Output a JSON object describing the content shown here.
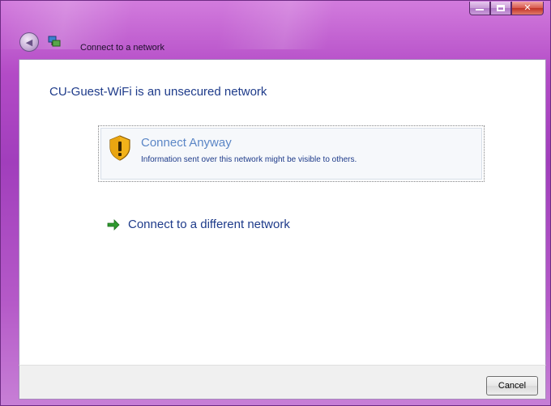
{
  "window": {
    "title": "Connect to a network"
  },
  "content": {
    "heading": "CU-Guest-WiFi is an unsecured network",
    "options": [
      {
        "title": "Connect Anyway",
        "description": "Information sent over this network might be visible to others."
      }
    ],
    "different_network_link": "Connect to a different network"
  },
  "footer": {
    "cancel_label": "Cancel"
  },
  "colors": {
    "frame_accent": "#b34bc6",
    "heading_text": "#1e3b8a",
    "link_text": "#5b86c6",
    "arrow_green": "#2e9a2e"
  }
}
